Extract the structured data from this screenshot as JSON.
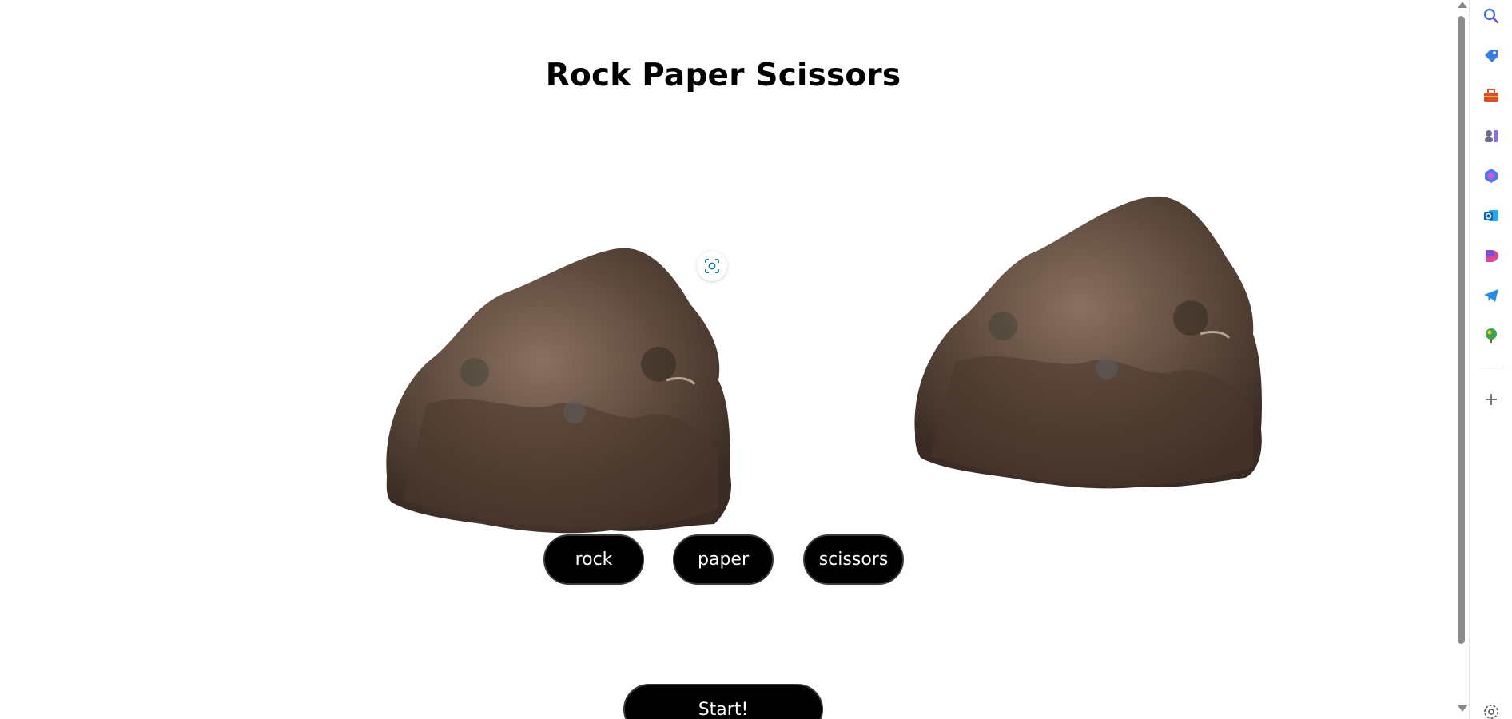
{
  "page": {
    "title": "Rock Paper Scissors"
  },
  "images": {
    "left_alt": "rock",
    "right_alt": "rock"
  },
  "choices": {
    "rock_label": "rock",
    "paper_label": "paper",
    "scissors_label": "scissors"
  },
  "start": {
    "label": "Start!"
  },
  "sidebar": {
    "icons": [
      "search-icon",
      "tag-icon",
      "toolbox-icon",
      "games-icon",
      "copilot-icon",
      "outlook-icon",
      "designer-icon",
      "telegram-icon",
      "tree-icon",
      "add-icon",
      "settings-icon"
    ]
  },
  "colors": {
    "button_bg": "#000000",
    "button_text": "#ffffff",
    "rock_brown": "#5b4538"
  }
}
